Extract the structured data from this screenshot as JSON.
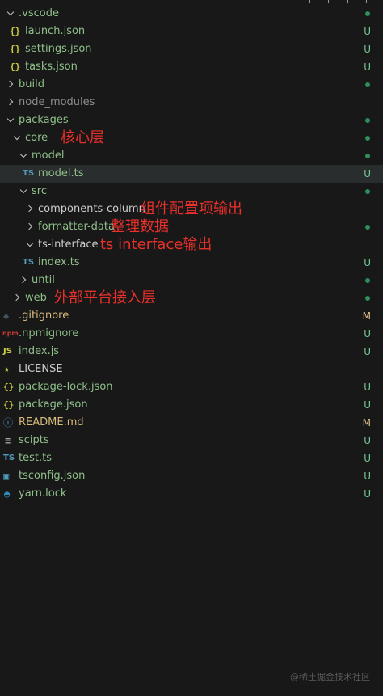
{
  "tree": {
    "vscode_folder": ".vscode",
    "launch_json": "launch.json",
    "settings_json": "settings.json",
    "tasks_json": "tasks.json",
    "build_folder": "build",
    "node_modules_folder": "node_modules",
    "packages_folder": "packages",
    "core_folder": "core",
    "model_folder": "model",
    "model_ts": "model.ts",
    "src_folder": "src",
    "components_column_folder": "components-column",
    "formatter_data_folder": "formatter-data",
    "ts_interface_folder": "ts-interface",
    "index_ts": "index.ts",
    "until_folder": "until",
    "web_folder": "web",
    "gitignore": ".gitignore",
    "npmignore": ".npmignore",
    "index_js": "index.js",
    "license": "LICENSE",
    "package_lock_json": "package-lock.json",
    "package_json": "package.json",
    "readme": "README.md",
    "scipts": "scipts",
    "test_ts": "test.ts",
    "tsconfig_json": "tsconfig.json",
    "yarn_lock": "yarn.lock"
  },
  "status": {
    "untracked": "U",
    "modified": "M"
  },
  "icons": {
    "json": "{}",
    "ts": "TS",
    "js": "JS",
    "npm": "npm",
    "git": "git-icon",
    "license": "license-icon",
    "info": "info-icon",
    "lines": "lines-icon",
    "tsconfig": "tsconfig-icon",
    "yarn": "yarn-icon"
  },
  "annotations": {
    "core": "核心层",
    "components": "组件配置项输出",
    "formatter": "整理数据",
    "ts_interface": "ts interface输出",
    "web": "外部平台接入层"
  },
  "watermark": "@稀土掘金技术社区",
  "colors": {
    "background": "#181818",
    "untracked": "#73c991",
    "modified": "#e2c08d",
    "annotation": "#e8302b",
    "dot": "#2f8f5c"
  }
}
